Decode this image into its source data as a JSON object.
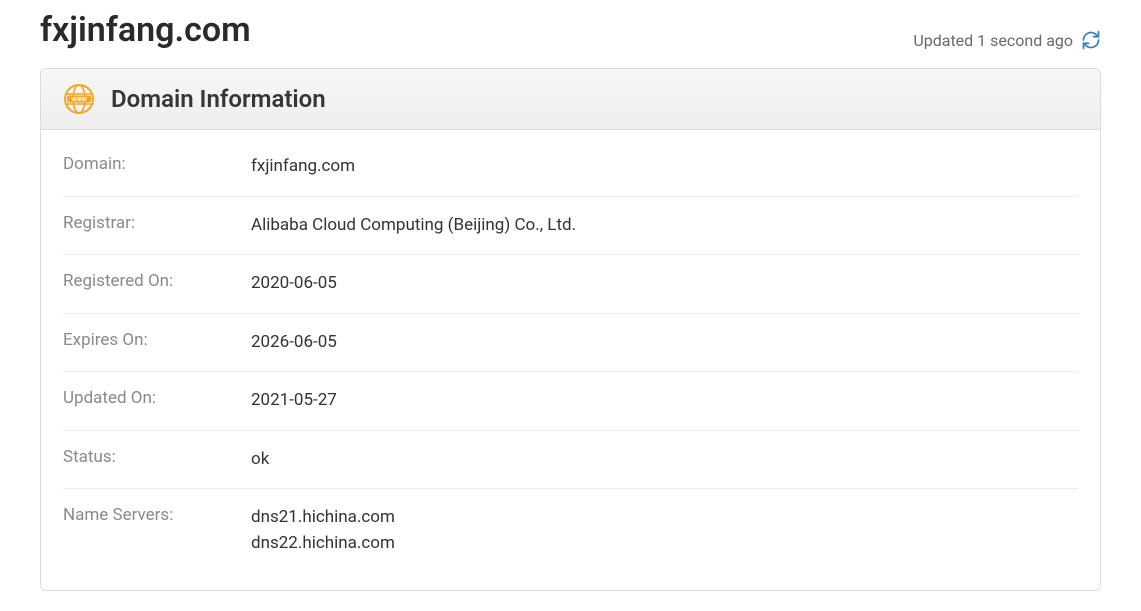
{
  "header": {
    "title": "fxjinfang.com",
    "updated_text": "Updated 1 second ago"
  },
  "panel": {
    "title": "Domain Information"
  },
  "info": {
    "rows": [
      {
        "label": "Domain:",
        "value": "fxjinfang.com"
      },
      {
        "label": "Registrar:",
        "value": "Alibaba Cloud Computing (Beijing) Co., Ltd."
      },
      {
        "label": "Registered On:",
        "value": "2020-06-05"
      },
      {
        "label": "Expires On:",
        "value": "2026-06-05"
      },
      {
        "label": "Updated On:",
        "value": "2021-05-27"
      },
      {
        "label": "Status:",
        "value": "ok"
      },
      {
        "label": "Name Servers:",
        "value": "dns21.hichina.com\ndns22.hichina.com"
      }
    ]
  }
}
